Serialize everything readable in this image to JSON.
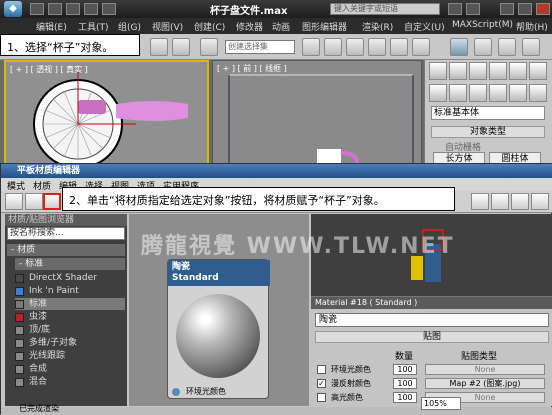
{
  "title": "杯子盘文件.max",
  "search_placeholder": "键入关键字或短语",
  "menu": [
    "编辑(E)",
    "工具(T)",
    "组(G)",
    "视图(V)",
    "创建(C)",
    "修改器",
    "动画",
    "图形编辑器",
    "渲染(R)",
    "自定义(U)",
    "MAXScript(M)",
    "帮助(H)"
  ],
  "selection_set_placeholder": "创建选择集",
  "callout1": "1、选择“杯子”对象。",
  "callout2": "2、单击“将材质指定给选定对象”按钮，将材质赋予“杯子”对象。",
  "viewport_left_label": "[ + ] [ 透视 ] [ 真实 ]",
  "viewport_right_label": "[ + ] [ 前 ] [ 线框 ]",
  "cmd_panel": {
    "dropdown": "标准基本体",
    "object_type": "对象类型",
    "auto_grid": "自动栅格",
    "box": "长方体",
    "cylinder": "圆柱体"
  },
  "mat_editor": {
    "title": "平板材质编辑器",
    "menu": [
      "模式",
      "材质",
      "编辑",
      "选择",
      "视图",
      "选项",
      "实用程序"
    ],
    "browser_title": "材质/贴图浏览器",
    "browser_search": "按名称搜索...",
    "group_materials": "- 材质",
    "group_standard": "- 标准",
    "items": [
      {
        "label": "DirectX Shader",
        "color": "#4a4a4a"
      },
      {
        "label": "Ink 'n Paint",
        "color": "#3b7fd9"
      },
      {
        "label": "标准",
        "color": "#7a7a7a",
        "selected": true
      },
      {
        "label": "虫漆",
        "color": "#c02020"
      },
      {
        "label": "顶/底",
        "color": "#8a8a8a"
      },
      {
        "label": "多维/子对象",
        "color": "#8a8a8a"
      },
      {
        "label": "光线跟踪",
        "color": "#8a8a8a"
      },
      {
        "label": "合成",
        "color": "#8a8a8a"
      },
      {
        "label": "混合",
        "color": "#8a8a8a"
      }
    ],
    "node_title": "陶瓷",
    "node_subtitle": "Standard",
    "node_slot": "环境光颜色",
    "watermark": "腾龍視覺 WWW.TLW.NET",
    "material_header": "Material #18 ( Standard )",
    "material_name": "陶瓷",
    "maps_header": "贴图",
    "col_amount": "数量",
    "col_map_type": "贴图类型",
    "maps": [
      {
        "name": "环境光颜色",
        "amount": "100",
        "map": "None",
        "checked": false
      },
      {
        "name": "漫反射颜色",
        "amount": "100",
        "map": "Map #2 (图案.jpg)",
        "checked": true
      },
      {
        "name": "高光颜色",
        "amount": "100",
        "map": "None",
        "checked": false
      }
    ],
    "status": "已完成渲染",
    "zoom": "105%"
  }
}
